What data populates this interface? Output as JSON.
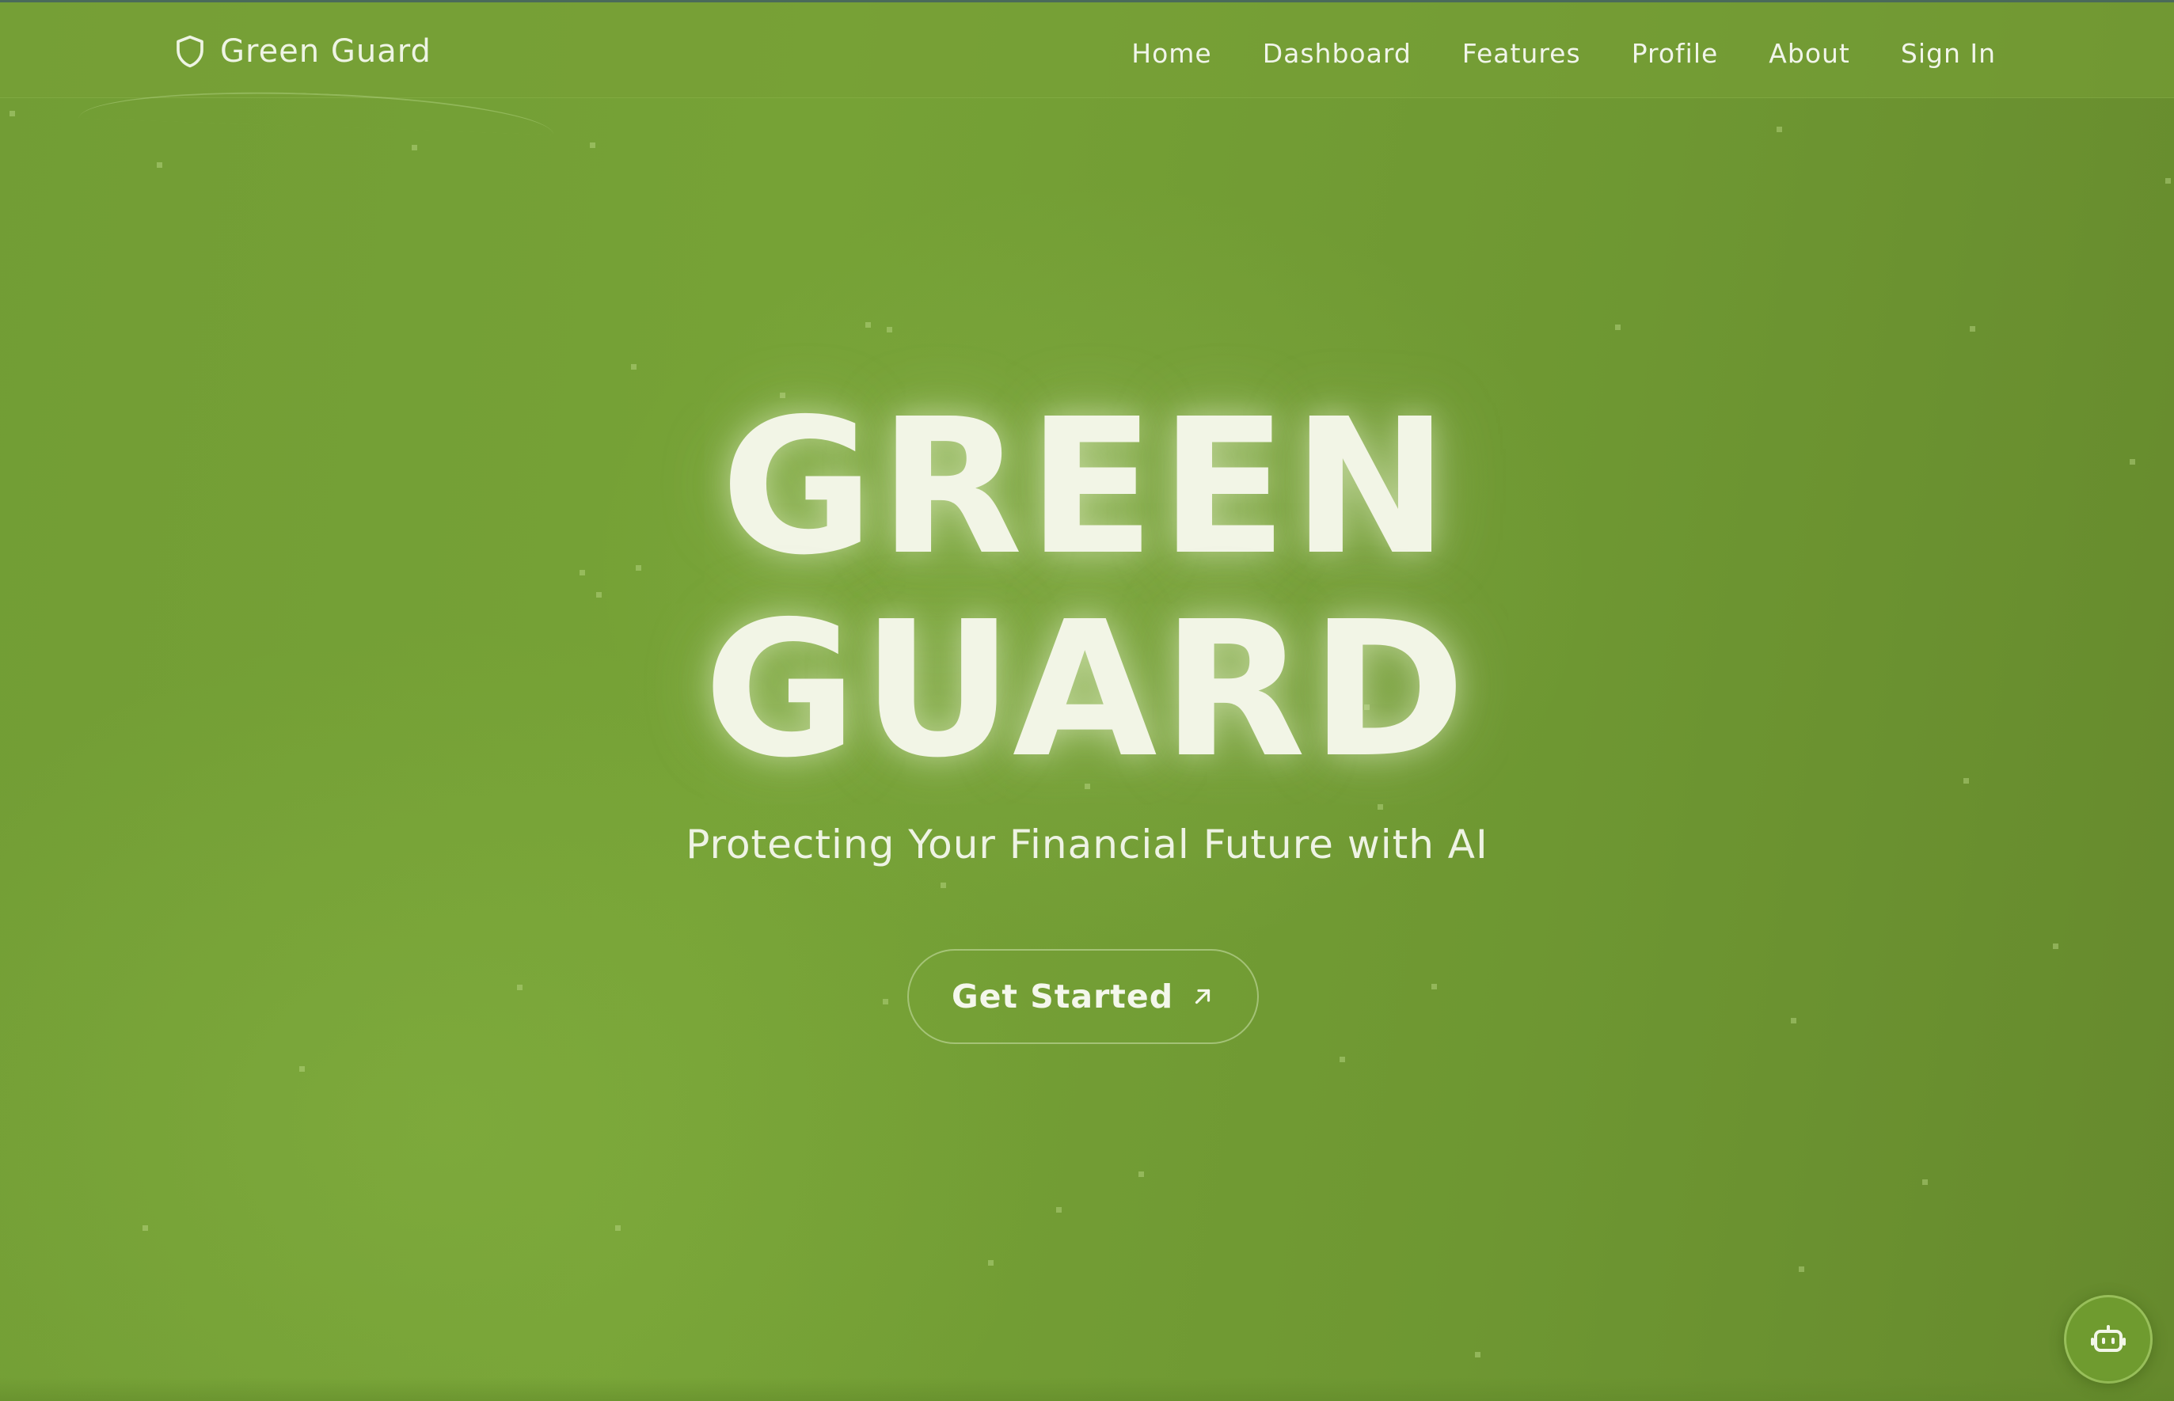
{
  "navbar": {
    "brand": "Green Guard",
    "brand_icon": "shield-icon",
    "links": [
      {
        "label": "Home"
      },
      {
        "label": "Dashboard"
      },
      {
        "label": "Features"
      },
      {
        "label": "Profile"
      },
      {
        "label": "About"
      },
      {
        "label": "Sign In"
      }
    ]
  },
  "hero": {
    "title_line1": "GREEN",
    "title_line2": "GUARD",
    "subtitle": "Protecting Your Financial Future with AI",
    "cta_label": "Get Started",
    "cta_icon": "arrow-up-right-icon"
  },
  "chat_widget": {
    "icon": "robot-icon"
  },
  "colors": {
    "background": "#729d35",
    "text": "#f2f5e6",
    "accent": "#6f9b2f"
  }
}
